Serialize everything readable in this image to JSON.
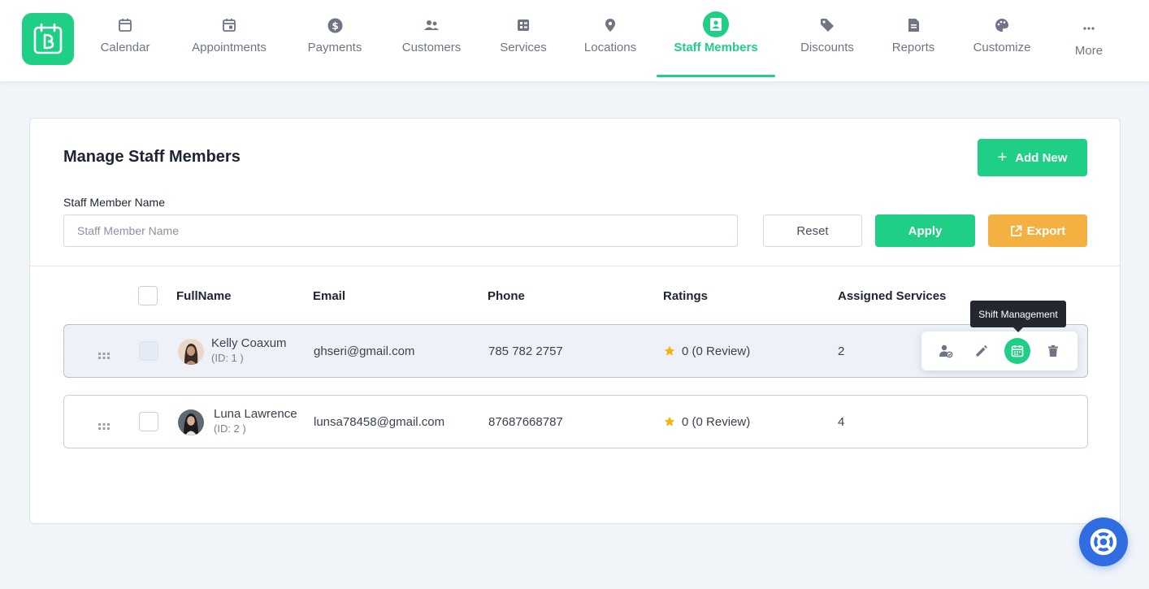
{
  "nav": {
    "items": [
      {
        "label": "Calendar",
        "icon": "calendar-icon"
      },
      {
        "label": "Appointments",
        "icon": "appointments-icon"
      },
      {
        "label": "Payments",
        "icon": "dollar-icon"
      },
      {
        "label": "Customers",
        "icon": "customers-icon"
      },
      {
        "label": "Services",
        "icon": "services-icon"
      },
      {
        "label": "Locations",
        "icon": "location-pin-icon"
      },
      {
        "label": "Staff Members",
        "icon": "staff-badge-icon",
        "active": true
      },
      {
        "label": "Discounts",
        "icon": "tag-icon"
      },
      {
        "label": "Reports",
        "icon": "report-icon"
      },
      {
        "label": "Customize",
        "icon": "palette-icon"
      },
      {
        "label": "More",
        "icon": "ellipsis-icon"
      }
    ]
  },
  "page": {
    "title": "Manage Staff Members",
    "add_new_label": "Add New",
    "filter_label": "Staff Member Name",
    "filter_placeholder": "Staff Member Name",
    "filter_value": "",
    "reset_label": "Reset",
    "apply_label": "Apply",
    "export_label": "Export"
  },
  "table": {
    "headers": {
      "fullname": "FullName",
      "email": "Email",
      "phone": "Phone",
      "ratings": "Ratings",
      "assigned_services": "Assigned Services"
    },
    "rows": [
      {
        "name": "Kelly Coaxum",
        "id_text": "(ID: 1 )",
        "email": "ghseri@gmail.com",
        "phone": "785 782 2757",
        "rating": "0 (0 Review)",
        "assigned_services": "2"
      },
      {
        "name": "Luna Lawrence",
        "id_text": "(ID: 2 )",
        "email": "lunsa78458@gmail.com",
        "phone": "87687668787",
        "rating": "0 (0 Review)",
        "assigned_services": "4"
      }
    ]
  },
  "row_actions": {
    "tooltip": "Shift Management",
    "icons": [
      "special-days-icon",
      "edit-pencil-icon",
      "shift-calendar-icon",
      "trash-icon"
    ]
  },
  "colors": {
    "primary": "#1ecf85",
    "export": "#f5b042",
    "help": "#2f6de0",
    "star": "#f4b40b"
  }
}
